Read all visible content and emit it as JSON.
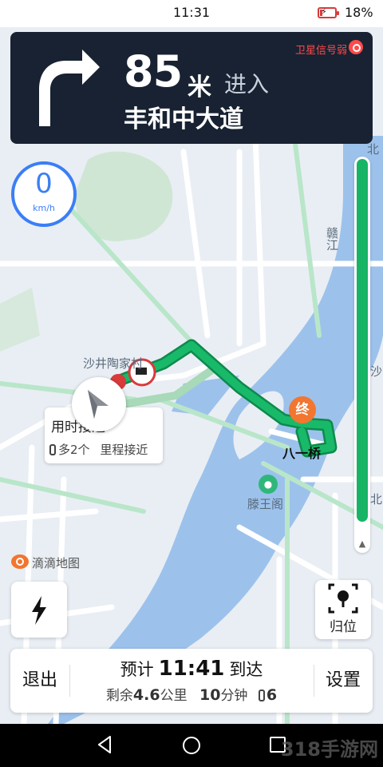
{
  "status_bar": {
    "time": "11:31",
    "battery_percent": "18%",
    "battery_level": 0.18,
    "battery_color": "#d93a3a"
  },
  "guidance": {
    "distance": "85",
    "unit": "米",
    "action": "进入",
    "road_name": "丰和中大道",
    "turn_icon": "turn-right-arrow-icon",
    "gps_warning": "卫星信号弱"
  },
  "speed": {
    "value": "0",
    "unit": "km/h"
  },
  "route_progress": {
    "remaining_fraction": 0.97,
    "color": "#18b466"
  },
  "map": {
    "labels": {
      "shajing": "沙井陶家村",
      "ganjiang": "赣江",
      "end_marker": "终",
      "bayi_bridge": "八一桥",
      "tengwang": "滕王阁",
      "north": "北",
      "sha": "沙",
      "bei": "北"
    },
    "attribution": "滴滴地图"
  },
  "route_bubble": {
    "title": "用时接近",
    "lights_more": "多2个",
    "distance_note": "里程接近"
  },
  "buttons": {
    "locate": "归位",
    "exit": "退出",
    "settings": "设置"
  },
  "trip_summary": {
    "eta_prefix": "预计",
    "eta_time": "11:41",
    "eta_suffix": "到达",
    "remaining_prefix": "剩余",
    "remaining_distance": "4.6",
    "distance_unit": "公里",
    "remaining_minutes": "10",
    "minutes_unit": "分钟",
    "traffic_lights": "6"
  },
  "watermark": "318手游网"
}
